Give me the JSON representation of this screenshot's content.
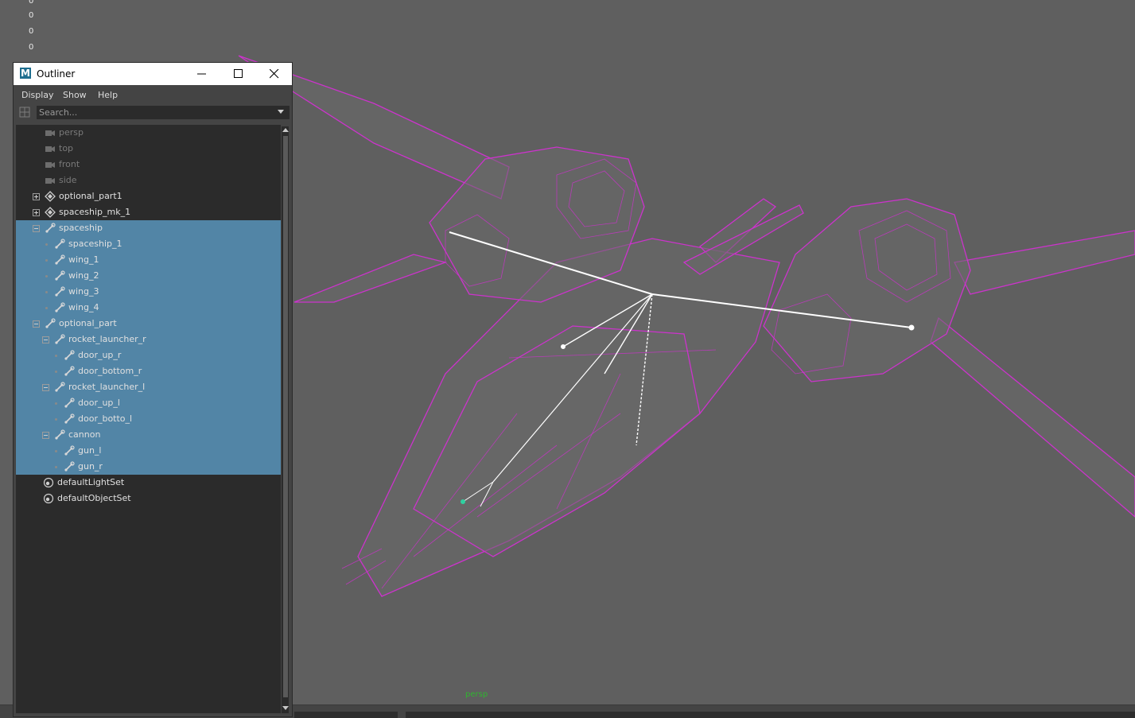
{
  "viewport": {
    "camera_label": "persp",
    "hud_values": [
      "0",
      "0",
      "0",
      "0"
    ],
    "wireframe_color": "#cc33cc"
  },
  "outliner": {
    "title": "Outliner",
    "menus": [
      "Display",
      "Show",
      "Help"
    ],
    "search_placeholder": "Search...",
    "selection_color": "#5285a6",
    "items": [
      {
        "label": "persp",
        "icon": "camera-icon",
        "depth": 0,
        "expander": "none",
        "selected": false,
        "dim": true
      },
      {
        "label": "top",
        "icon": "camera-icon",
        "depth": 0,
        "expander": "none",
        "selected": false,
        "dim": true
      },
      {
        "label": "front",
        "icon": "camera-icon",
        "depth": 0,
        "expander": "none",
        "selected": false,
        "dim": true
      },
      {
        "label": "side",
        "icon": "camera-icon",
        "depth": 0,
        "expander": "none",
        "selected": false,
        "dim": true
      },
      {
        "label": "optional_part1",
        "icon": "group-icon",
        "depth": 0,
        "expander": "plus",
        "selected": false,
        "dim": false
      },
      {
        "label": "spaceship_mk_1",
        "icon": "group-icon",
        "depth": 0,
        "expander": "plus",
        "selected": false,
        "dim": false
      },
      {
        "label": "spaceship",
        "icon": "joint-icon",
        "depth": 0,
        "expander": "minus",
        "selected": true,
        "dim": false
      },
      {
        "label": "spaceship_1",
        "icon": "joint-icon",
        "depth": 1,
        "expander": "none",
        "selected": true,
        "dim": false
      },
      {
        "label": "wing_1",
        "icon": "joint-icon",
        "depth": 1,
        "expander": "none",
        "selected": true,
        "dim": false
      },
      {
        "label": "wing_2",
        "icon": "joint-icon",
        "depth": 1,
        "expander": "none",
        "selected": true,
        "dim": false
      },
      {
        "label": "wing_3",
        "icon": "joint-icon",
        "depth": 1,
        "expander": "none",
        "selected": true,
        "dim": false
      },
      {
        "label": "wing_4",
        "icon": "joint-icon",
        "depth": 1,
        "expander": "none",
        "selected": true,
        "dim": false
      },
      {
        "label": "optional_part",
        "icon": "joint-icon",
        "depth": 0,
        "expander": "minus",
        "selected": true,
        "dim": false
      },
      {
        "label": "rocket_launcher_r",
        "icon": "joint-icon",
        "depth": 1,
        "expander": "minus",
        "selected": true,
        "dim": false
      },
      {
        "label": "door_up_r",
        "icon": "joint-icon",
        "depth": 2,
        "expander": "none",
        "selected": true,
        "dim": false
      },
      {
        "label": "door_bottom_r",
        "icon": "joint-icon",
        "depth": 2,
        "expander": "none",
        "selected": true,
        "dim": false
      },
      {
        "label": "rocket_launcher_l",
        "icon": "joint-icon",
        "depth": 1,
        "expander": "minus",
        "selected": true,
        "dim": false
      },
      {
        "label": "door_up_l",
        "icon": "joint-icon",
        "depth": 2,
        "expander": "none",
        "selected": true,
        "dim": false
      },
      {
        "label": "door_botto_l",
        "icon": "joint-icon",
        "depth": 2,
        "expander": "none",
        "selected": true,
        "dim": false
      },
      {
        "label": "cannon",
        "icon": "joint-icon",
        "depth": 1,
        "expander": "minus",
        "selected": true,
        "dim": false
      },
      {
        "label": "gun_l",
        "icon": "joint-icon",
        "depth": 2,
        "expander": "none",
        "selected": true,
        "dim": false
      },
      {
        "label": "gun_r",
        "icon": "joint-icon",
        "depth": 2,
        "expander": "none",
        "selected": true,
        "dim": false
      },
      {
        "label": "defaultLightSet",
        "icon": "set-icon",
        "depth": 0,
        "expander": "none",
        "selected": false,
        "dim": false
      },
      {
        "label": "defaultObjectSet",
        "icon": "set-icon",
        "depth": 0,
        "expander": "none",
        "selected": false,
        "dim": false
      }
    ]
  }
}
